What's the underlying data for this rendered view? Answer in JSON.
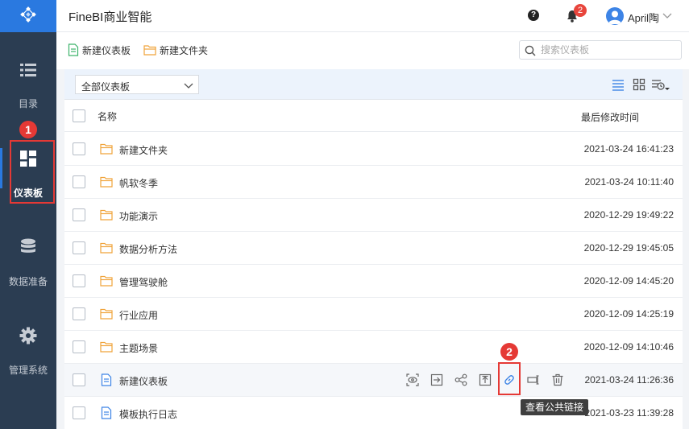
{
  "header": {
    "title": "FineBI商业智能",
    "help_icon_text": "?",
    "notification_count": "2",
    "user_name": "April陶"
  },
  "sidebar": {
    "items": [
      {
        "label": "目录",
        "icon": "list-icon"
      },
      {
        "label": "仪表板",
        "icon": "dashboard-icon"
      },
      {
        "label": "数据准备",
        "icon": "database-icon"
      },
      {
        "label": "管理系统",
        "icon": "gear-icon"
      }
    ]
  },
  "toolbar": {
    "new_dashboard": "新建仪表板",
    "new_folder": "新建文件夹",
    "search_placeholder": "搜索仪表板"
  },
  "filter": {
    "selected": "全部仪表板"
  },
  "table": {
    "columns": [
      "名称",
      "最后修改时间"
    ],
    "rows": [
      {
        "type": "folder",
        "name": "新建文件夹",
        "time": "2021-03-24 16:41:23"
      },
      {
        "type": "folder",
        "name": "帆软冬季",
        "time": "2021-03-24 10:11:40"
      },
      {
        "type": "folder",
        "name": "功能演示",
        "time": "2020-12-29 19:49:22"
      },
      {
        "type": "folder",
        "name": "数据分析方法",
        "time": "2020-12-29 19:45:05"
      },
      {
        "type": "folder",
        "name": "管理驾驶舱",
        "time": "2020-12-09 14:45:20"
      },
      {
        "type": "folder",
        "name": "行业应用",
        "time": "2020-12-09 14:25:19"
      },
      {
        "type": "folder",
        "name": "主题场景",
        "time": "2020-12-09 14:10:46"
      },
      {
        "type": "dashboard",
        "name": "新建仪表板",
        "time": "2021-03-24 11:26:36"
      },
      {
        "type": "dashboard",
        "name": "模板执行日志",
        "time": "2021-03-23 11:39:28"
      }
    ]
  },
  "row_actions": [
    "preview-icon",
    "move-icon",
    "share-icon",
    "export-icon",
    "link-icon",
    "rename-icon",
    "delete-icon"
  ],
  "tooltip": "查看公共链接",
  "annotations": [
    "1",
    "2"
  ],
  "colors": {
    "accent": "#2a79e0",
    "sidebar": "#2b3d52",
    "folder": "#f0a33a",
    "annotation": "#e53935"
  }
}
